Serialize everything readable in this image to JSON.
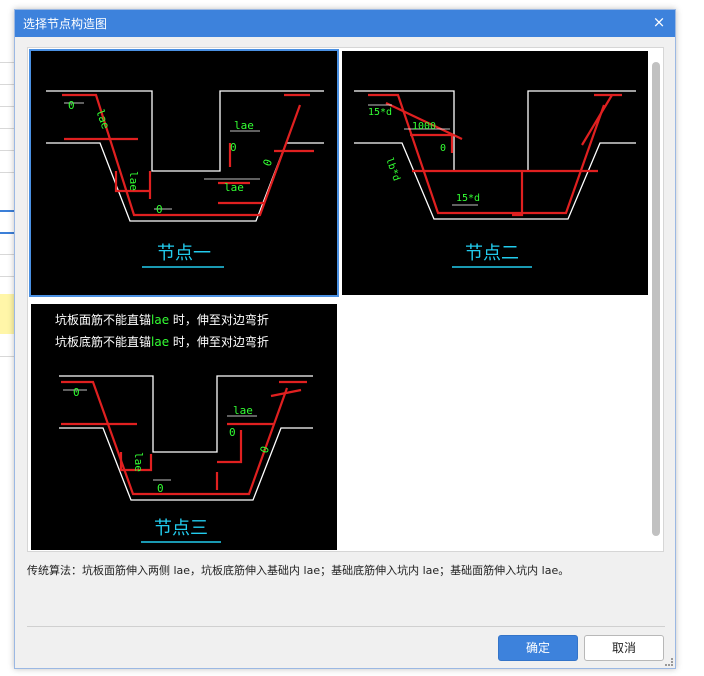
{
  "dialog": {
    "title": "选择节点构造图",
    "close_glyph": "×"
  },
  "nodes": [
    {
      "caption": "节点一",
      "labels": {
        "lae_top": "lae",
        "lae_bottom": "lae",
        "lae_vertical": "lae",
        "d0_left": "0",
        "d0_mid": "0",
        "d0_bottom": "0",
        "d0_right": "0",
        "lae_slope": "lae"
      }
    },
    {
      "caption": "节点二",
      "labels": {
        "d15_top": "15*d",
        "len_1000": "1000",
        "d0_mid": "0",
        "slope_label": "lb*d",
        "d15_bottom": "15*d"
      }
    },
    {
      "caption": "节点三",
      "note_line1_prefix": "坑板面筋不能直锚",
      "note_line1_lae": "lae",
      "note_line1_suffix": " 时，伸至对边弯折",
      "note_line2_prefix": "坑板底筋不能直锚",
      "note_line2_lae": "lae",
      "note_line2_suffix": " 时，伸至对边弯折",
      "labels": {
        "lae_top": "lae",
        "lae_vertical": "lae",
        "d0_left": "0",
        "d0_mid": "0",
        "d0_bottom": "0",
        "d0_right": "0"
      }
    }
  ],
  "description": "传统算法：坑板面筋伸入两侧 lae，坑板底筋伸入基础内 lae；基础底筋伸入坑内 lae；基础面筋伸入坑内 lae。",
  "buttons": {
    "ok": "确定",
    "cancel": "取消"
  },
  "colors": {
    "accent": "#3d82dc",
    "rebar": "#e02020",
    "dimension": "#33ff33",
    "caption": "#22ccee"
  }
}
